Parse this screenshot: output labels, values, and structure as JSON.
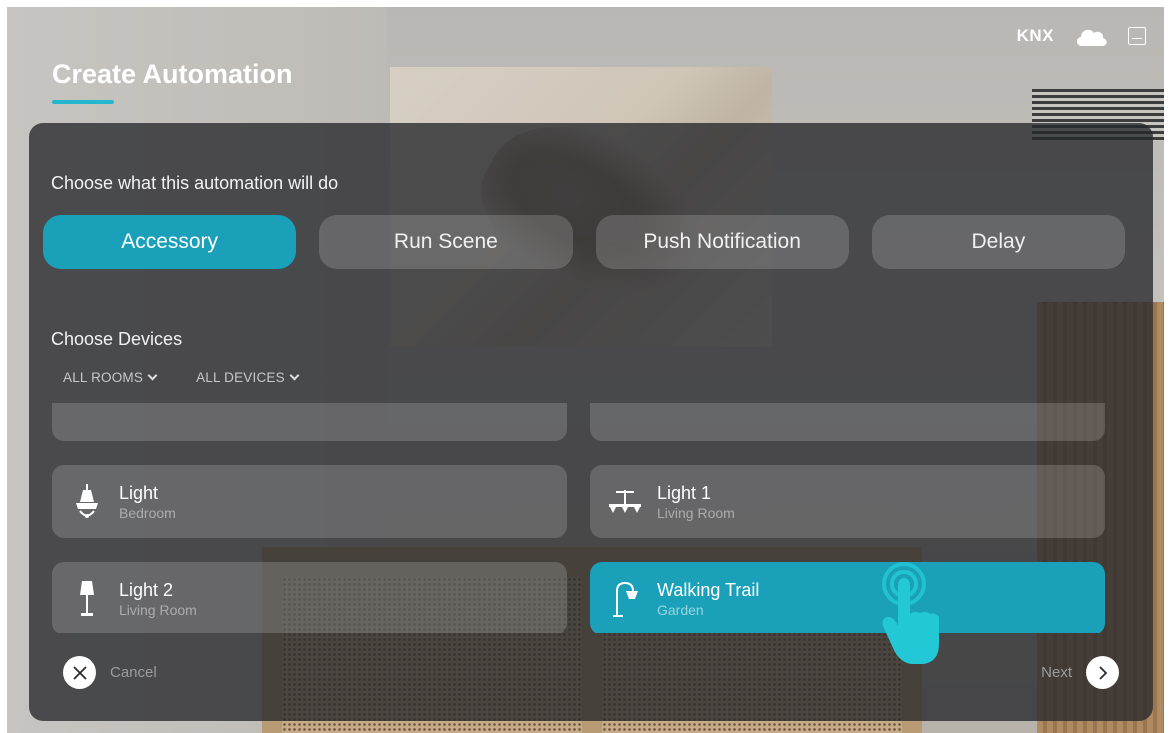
{
  "status_bar": {
    "protocol_label": "KNX",
    "icons": [
      "cloud-icon",
      "home-icon"
    ]
  },
  "page_title": "Create Automation",
  "action_section": {
    "heading": "Choose what this automation will do",
    "tabs": [
      {
        "label": "Accessory",
        "active": true
      },
      {
        "label": "Run Scene",
        "active": false
      },
      {
        "label": "Push Notification",
        "active": false
      },
      {
        "label": "Delay",
        "active": false
      }
    ]
  },
  "devices_section": {
    "heading": "Choose Devices",
    "filters": {
      "rooms": "ALL ROOMS",
      "devices": "ALL DEVICES"
    },
    "devices": [
      {
        "name": "Light",
        "room": "Bedroom",
        "icon": "chandelier-icon",
        "selected": false
      },
      {
        "name": "Light 1",
        "room": "Living Room",
        "icon": "ceiling-light-icon",
        "selected": false
      },
      {
        "name": "Light 2",
        "room": "Living Room",
        "icon": "floor-lamp-icon",
        "selected": false
      },
      {
        "name": "Walking Trail",
        "room": "Garden",
        "icon": "garden-lamp-icon",
        "selected": true
      }
    ]
  },
  "footer": {
    "cancel_label": "Cancel",
    "next_label": "Next"
  },
  "colors": {
    "accent": "#1aa0b8",
    "underline": "#25b7cf",
    "panel": "#26282c"
  }
}
